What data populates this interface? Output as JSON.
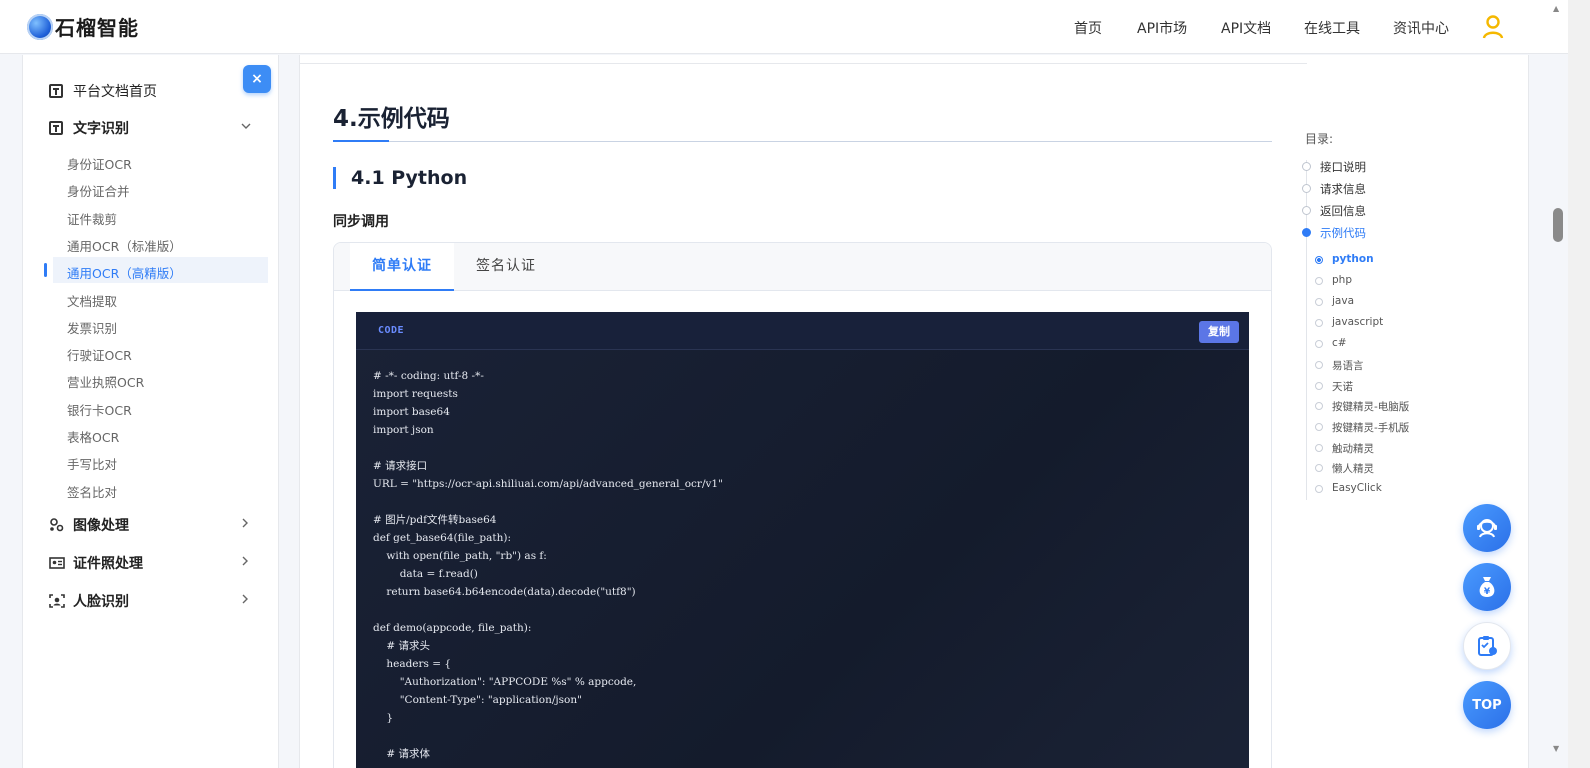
{
  "brand": {
    "name": "石榴智能"
  },
  "nav": {
    "items": [
      {
        "label": "首页"
      },
      {
        "label": "API市场"
      },
      {
        "label": "API文档"
      },
      {
        "label": "在线工具"
      },
      {
        "label": "资讯中心"
      }
    ]
  },
  "sidebar": {
    "close": "×",
    "home": "平台文档首页",
    "ocr_group": "文字识别",
    "ocr_items": [
      {
        "label": "身份证OCR"
      },
      {
        "label": "身份证合并"
      },
      {
        "label": "证件裁剪"
      },
      {
        "label": "通用OCR（标准版）"
      },
      {
        "label": "通用OCR（高精版）"
      },
      {
        "label": "文档提取"
      },
      {
        "label": "发票识别"
      },
      {
        "label": "行驶证OCR"
      },
      {
        "label": "营业执照OCR"
      },
      {
        "label": "银行卡OCR"
      },
      {
        "label": "表格OCR"
      },
      {
        "label": "手写比对"
      },
      {
        "label": "签名比对"
      }
    ],
    "active_item": "通用OCR（高精版）",
    "groups": [
      {
        "label": "图像处理"
      },
      {
        "label": "证件照处理"
      },
      {
        "label": "人脸识别"
      }
    ]
  },
  "main": {
    "section_title": "4.示例代码",
    "subsection_title": "4.1 Python",
    "sub_heading": "同步调用",
    "tabs": [
      {
        "label": "简单认证"
      },
      {
        "label": "签名认证"
      }
    ],
    "active_tab": "简单认证",
    "code": {
      "label": "CODE",
      "copy_label": "复制",
      "content": "# -*- coding: utf-8 -*-\nimport requests\nimport base64\nimport json\n\n# 请求接口\nURL = \"https://ocr-api.shiliuai.com/api/advanced_general_ocr/v1\"\n\n# 图片/pdf文件转base64\ndef get_base64(file_path):\n    with open(file_path, \"rb\") as f:\n        data = f.read()\n    return base64.b64encode(data).decode(\"utf8\")\n\ndef demo(appcode, file_path):\n    # 请求头\n    headers = {\n        \"Authorization\": \"APPCODE %s\" % appcode,\n        \"Content-Type\": \"application/json\"\n    }\n\n    # 请求体"
    }
  },
  "toc": {
    "title": "目录:",
    "items": [
      {
        "label": "接口说明"
      },
      {
        "label": "请求信息"
      },
      {
        "label": "返回信息"
      },
      {
        "label": "示例代码"
      }
    ],
    "active_item": "示例代码",
    "sub_items": [
      {
        "label": "python"
      },
      {
        "label": "php"
      },
      {
        "label": "java"
      },
      {
        "label": "javascript"
      },
      {
        "label": "c#"
      },
      {
        "label": "易语言"
      },
      {
        "label": "天诺"
      },
      {
        "label": "按键精灵-电脑版"
      },
      {
        "label": "按键精灵-手机版"
      },
      {
        "label": "触动精灵"
      },
      {
        "label": "懒人精灵"
      },
      {
        "label": "EasyClick"
      }
    ],
    "active_sub": "python"
  },
  "floating": {
    "support_icon": "headset-icon",
    "price_icon": "money-bag-icon",
    "clipboard_icon": "clipboard-icon",
    "top_label": "TOP"
  },
  "colors": {
    "accent": "#2f7cf6",
    "code_bg": "#161d2f",
    "user_icon": "#f5b800"
  }
}
